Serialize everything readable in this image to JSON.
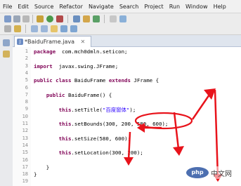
{
  "menu": [
    "File",
    "Edit",
    "Source",
    "Refactor",
    "Navigate",
    "Search",
    "Project",
    "Run",
    "Window",
    "Help"
  ],
  "editor_tab": {
    "label": "*BaiduFrame.java",
    "close": "✕"
  },
  "code_lines": [
    {
      "n": "1",
      "parts": [
        [
          "kw",
          "package"
        ],
        [
          "",
          "  com.mch0dmln.seticon;"
        ]
      ]
    },
    {
      "n": "2",
      "parts": []
    },
    {
      "n": "3",
      "parts": [
        [
          "kw",
          "import"
        ],
        [
          "",
          "  javax.swing.JFrame;"
        ]
      ]
    },
    {
      "n": "4",
      "parts": []
    },
    {
      "n": "5",
      "parts": [
        [
          "kw",
          "public class"
        ],
        [
          "",
          " BaiduFrame "
        ],
        [
          "kw",
          "extends"
        ],
        [
          "",
          " JFrame {"
        ]
      ]
    },
    {
      "n": "6",
      "parts": []
    },
    {
      "n": "7",
      "parts": [
        [
          "",
          "    "
        ],
        [
          "kw",
          "public"
        ],
        [
          "",
          " BaiduFrame() {"
        ]
      ]
    },
    {
      "n": "8",
      "parts": []
    },
    {
      "n": "9",
      "parts": [
        [
          "",
          "        "
        ],
        [
          "kw",
          "this"
        ],
        [
          "",
          ".setTitle("
        ],
        [
          "str",
          "\"百度窗体\""
        ],
        [
          "",
          ");"
        ]
      ]
    },
    {
      "n": "10",
      "parts": []
    },
    {
      "n": "11",
      "parts": [
        [
          "",
          "        "
        ],
        [
          "kw",
          "this"
        ],
        [
          "",
          ".setBounds(300, 200, 580, 600);"
        ]
      ]
    },
    {
      "n": "12",
      "parts": []
    },
    {
      "n": "13",
      "parts": [
        [
          "",
          "        "
        ],
        [
          "kw",
          "this"
        ],
        [
          "",
          ".setSize(580, 600);"
        ]
      ]
    },
    {
      "n": "14",
      "parts": []
    },
    {
      "n": "15",
      "parts": [
        [
          "",
          "        "
        ],
        [
          "kw",
          "this"
        ],
        [
          "",
          ".setLocation(300, 200);"
        ]
      ]
    },
    {
      "n": "16",
      "parts": []
    },
    {
      "n": "17",
      "parts": [
        [
          "",
          "    }"
        ]
      ]
    },
    {
      "n": "18",
      "parts": [
        [
          "",
          "}"
        ]
      ]
    },
    {
      "n": "19",
      "parts": []
    }
  ],
  "watermark": {
    "logo": "php",
    "text": "中文网"
  },
  "colors": {
    "annotation": "#e8131b",
    "keyword": "#7f0055",
    "string": "#2a00ff"
  }
}
